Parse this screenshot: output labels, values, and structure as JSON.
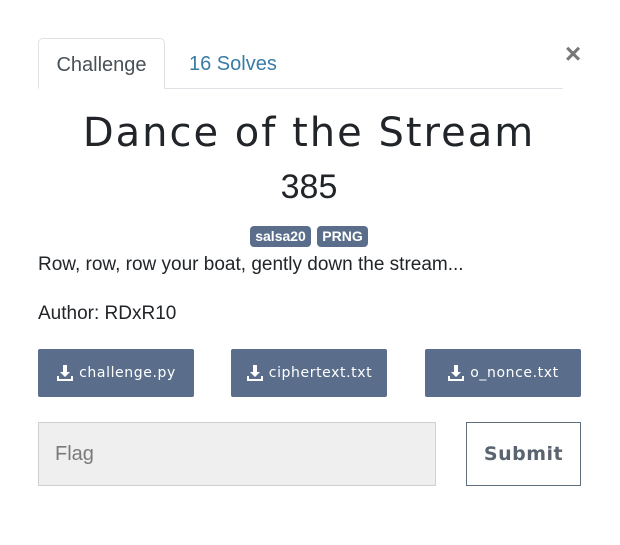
{
  "tabs": [
    {
      "label": "Challenge"
    },
    {
      "label": "16 Solves"
    }
  ],
  "close_icon": "×",
  "challenge": {
    "title": "Dance of the Stream",
    "points": "385",
    "tags": [
      "salsa20",
      "PRNG"
    ],
    "description": "Row, row, row your boat, gently down the stream...",
    "author": "Author: RDxR10"
  },
  "files": [
    {
      "name": "challenge.py",
      "icon": "download-icon"
    },
    {
      "name": "ciphertext.txt",
      "icon": "download-icon"
    },
    {
      "name": "o_nonce.txt",
      "icon": "download-icon"
    }
  ],
  "flag_form": {
    "placeholder": "Flag",
    "submit_label": "Submit"
  },
  "colors": {
    "accent": "#5a6e8c",
    "tab_link": "#3a7ca5"
  }
}
